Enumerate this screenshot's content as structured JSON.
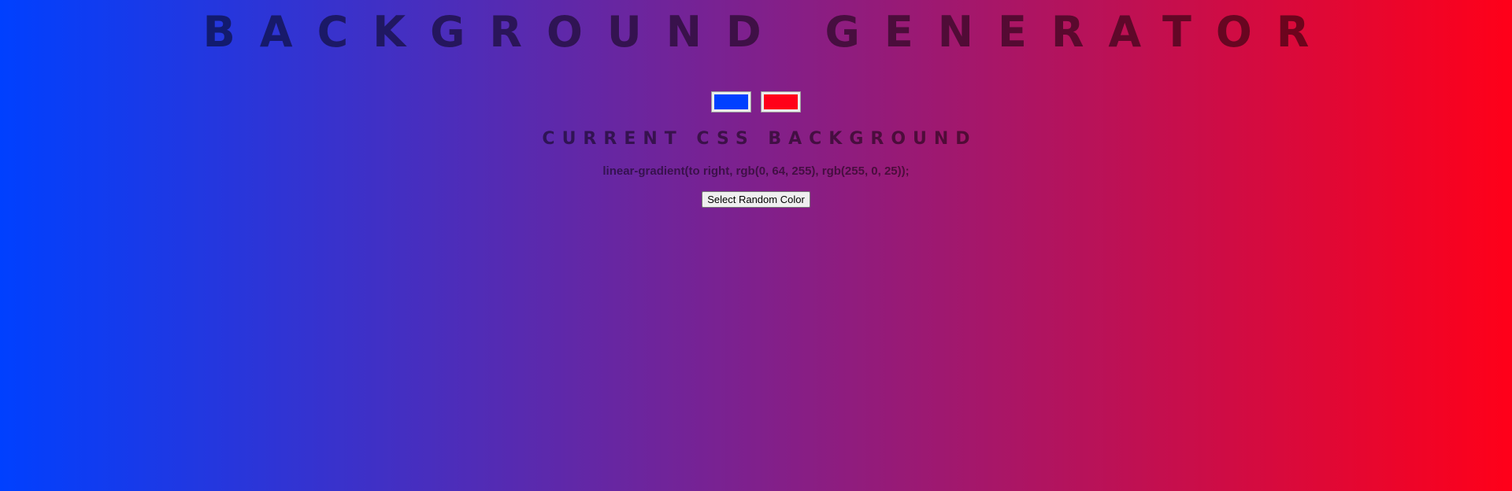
{
  "page": {
    "title": "BACKGROUND GENERATOR",
    "subtitle": "CURRENT CSS BACKGROUND",
    "css_value": "linear-gradient(to right, rgb(0, 64, 255), rgb(255, 0, 25));",
    "random_button_label": "Select Random Color"
  },
  "colors": {
    "color1": "#0040ff",
    "color2": "#ff0019"
  }
}
